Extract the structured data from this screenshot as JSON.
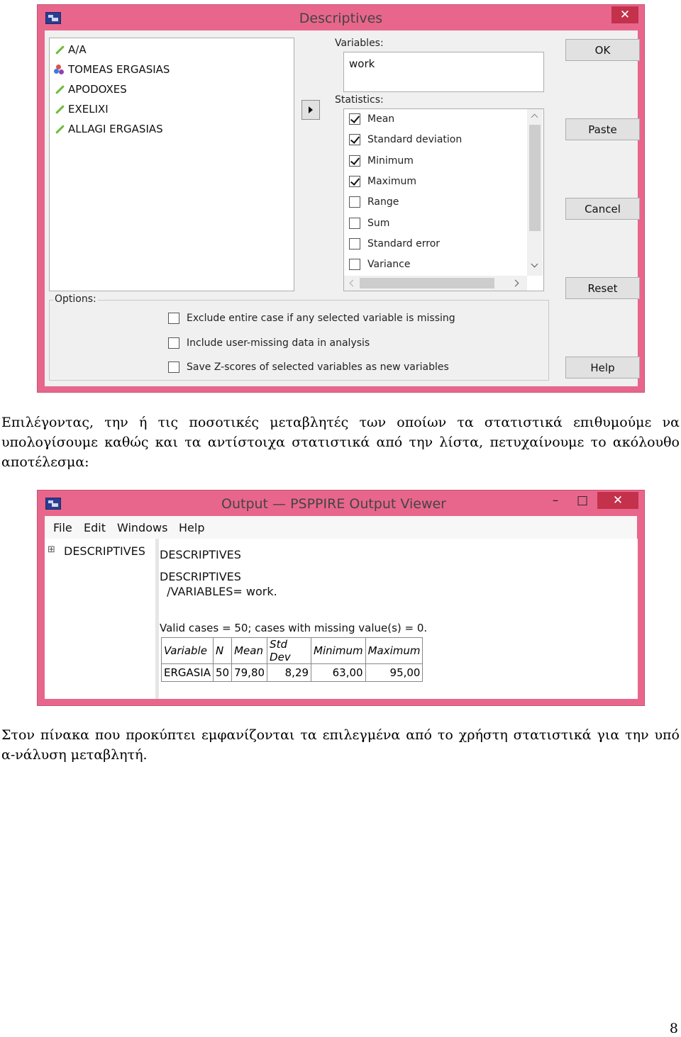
{
  "descriptives_dialog": {
    "title": "Descriptives",
    "close_glyph": "✕",
    "variables_list": [
      {
        "name": "A/A",
        "icon": "scale-pencil-icon"
      },
      {
        "name": "TOMEAS ERGASIAS",
        "icon": "nominal-balls-icon"
      },
      {
        "name": "APODOXES",
        "icon": "scale-pencil-icon"
      },
      {
        "name": "EXELIXI",
        "icon": "scale-pencil-icon"
      },
      {
        "name": "ALLAGI ERGASIAS",
        "icon": "scale-pencil-icon"
      }
    ],
    "variables_label": "Variables:",
    "selected_variables": [
      "work"
    ],
    "statistics_label": "Statistics:",
    "statistics": [
      {
        "label": "Mean",
        "checked": true
      },
      {
        "label": "Standard deviation",
        "checked": true
      },
      {
        "label": "Minimum",
        "checked": true
      },
      {
        "label": "Maximum",
        "checked": true
      },
      {
        "label": "Range",
        "checked": false
      },
      {
        "label": "Sum",
        "checked": false
      },
      {
        "label": "Standard error",
        "checked": false
      },
      {
        "label": "Variance",
        "checked": false
      }
    ],
    "options_label": "Options:",
    "options": [
      {
        "label": "Exclude entire case if any selected variable is missing",
        "checked": false
      },
      {
        "label": "Include user-missing data in analysis",
        "checked": false
      },
      {
        "label": "Save Z-scores of selected variables as new variables",
        "checked": false
      }
    ],
    "buttons": {
      "ok": "OK",
      "paste": "Paste",
      "cancel": "Cancel",
      "reset": "Reset",
      "help": "Help"
    }
  },
  "paragraph_1": "Επιλέγοντας, την ή τις ποσοτικές μεταβλητές των οποίων τα στατιστικά επιθυμούμε να υπολογίσουμε καθώς και τα αντίστοιχα στατιστικά από την λίστα, πετυχαίνουμε το ακόλουθο αποτέλεσμα:",
  "output_viewer": {
    "title": "Output — PSPPIRE Output Viewer",
    "minimize_glyph": "–",
    "maximize_glyph": "□",
    "close_glyph": "✕",
    "menu": [
      "File",
      "Edit",
      "Windows",
      "Help"
    ],
    "tree_expander": "⊞",
    "tree_item": "DESCRIPTIVES",
    "heading": "DESCRIPTIVES",
    "syntax_line1": "DESCRIPTIVES",
    "syntax_line2": "  /VARIABLES= work.",
    "valid_cases_line": "Valid cases = 50; cases with missing value(s) = 0.",
    "table": {
      "headers": [
        "Variable",
        "N",
        "Mean",
        "Std Dev",
        "Minimum",
        "Maximum"
      ],
      "rows": [
        [
          "ERGASIA",
          "50",
          "79,80",
          "8,29",
          "63,00",
          "95,00"
        ]
      ]
    }
  },
  "paragraph_2": "Στον πίνακα που προκύπτει εμφανίζονται τα επιλεγμένα από το χρήστη στατιστικά για την υπό α-νάλυση μεταβλητή.",
  "page_number": "8"
}
